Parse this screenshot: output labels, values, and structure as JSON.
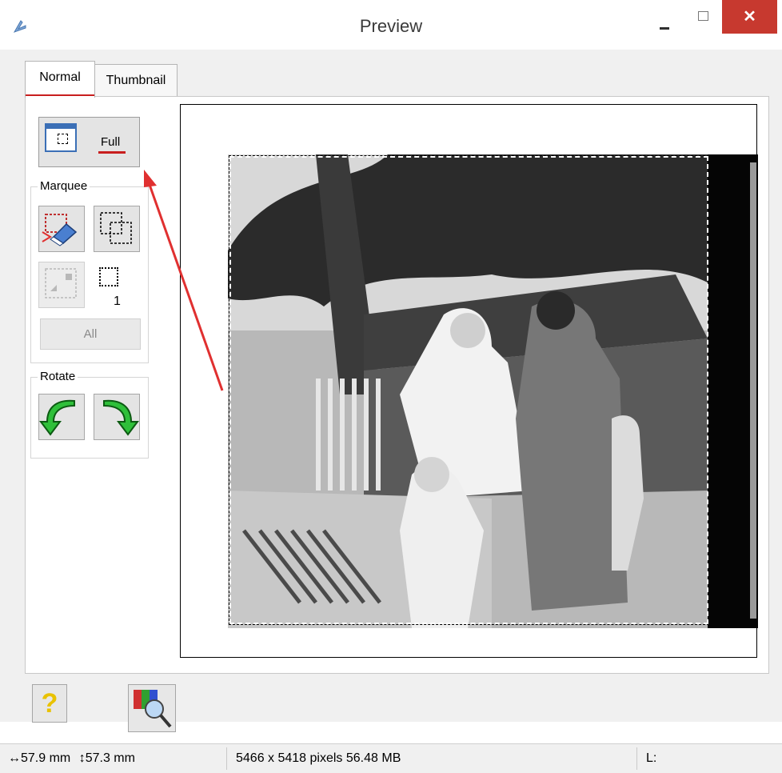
{
  "window": {
    "title": "Preview",
    "close_glyph": "✕"
  },
  "tabs": [
    {
      "label": "Normal",
      "selected": true
    },
    {
      "label": "Thumbnail",
      "selected": false
    }
  ],
  "toolbar": {
    "full_label": "Full",
    "marquee_group": "Marquee",
    "marquee_count": "1",
    "all_label": "All",
    "rotate_group": "Rotate"
  },
  "bottom_buttons": {
    "help_glyph": "?"
  },
  "status": {
    "width": "57.9 mm",
    "height": "57.3 mm",
    "pixels": "5466 x 5418 pixels 56.48 MB",
    "level": "L:"
  },
  "colors": {
    "close": "#c7392f",
    "accent_underline": "#c81e1e",
    "annotation_arrow": "#e03030"
  },
  "icons": [
    "app-icon",
    "full-preview-icon",
    "remove-marquee-icon",
    "duplicate-marquee-icon",
    "auto-exposure-icon",
    "rotate-left-icon",
    "rotate-right-icon",
    "help-icon",
    "zoom-icon"
  ]
}
